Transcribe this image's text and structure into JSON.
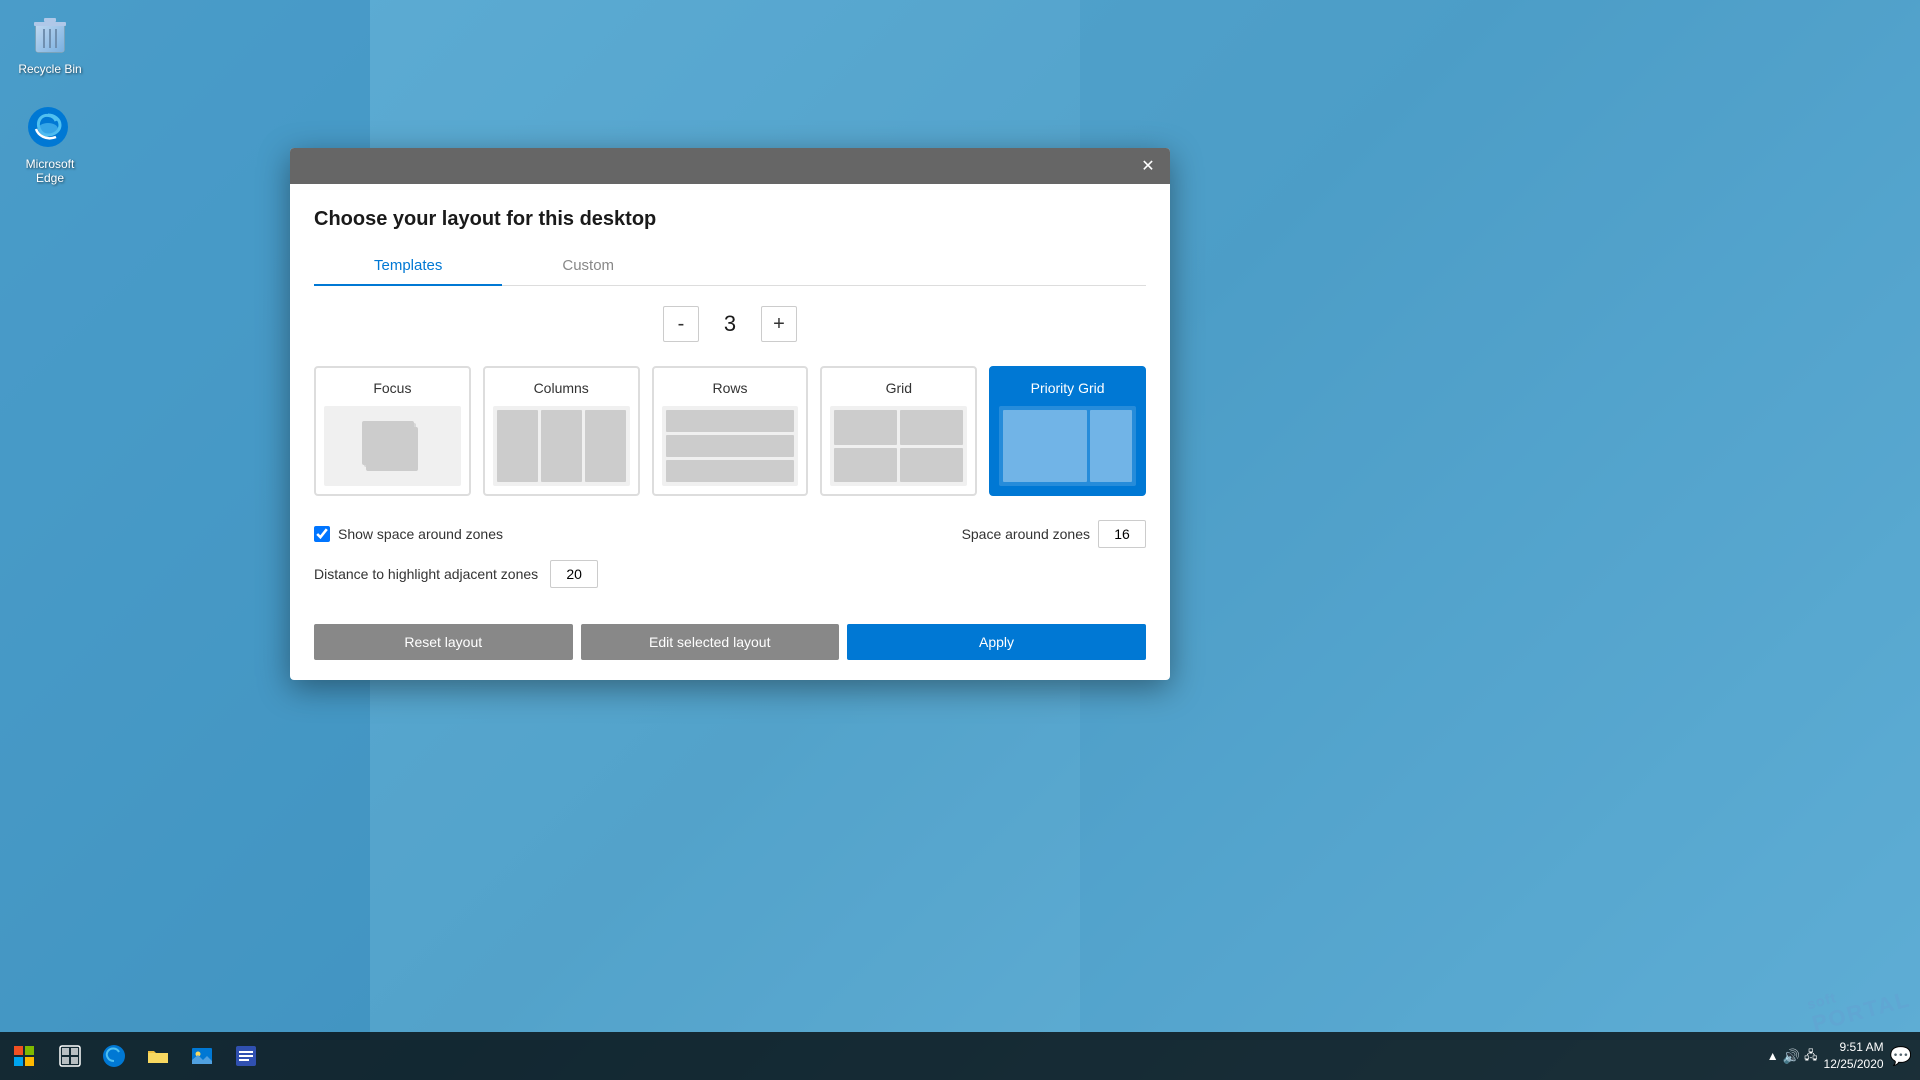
{
  "desktop": {
    "recycle_bin_label": "Recycle Bin",
    "edge_label": "Microsoft Edge"
  },
  "dialog": {
    "title": "Choose your layout for this desktop",
    "close_label": "✕",
    "tabs": [
      {
        "id": "templates",
        "label": "Templates",
        "active": true
      },
      {
        "id": "custom",
        "label": "Custom",
        "active": false
      }
    ],
    "zone_count": {
      "minus_label": "-",
      "count": "3",
      "plus_label": "+"
    },
    "layouts": [
      {
        "id": "focus",
        "name": "Focus",
        "selected": false
      },
      {
        "id": "columns",
        "name": "Columns",
        "selected": false
      },
      {
        "id": "rows",
        "name": "Rows",
        "selected": false
      },
      {
        "id": "grid",
        "name": "Grid",
        "selected": false
      },
      {
        "id": "priority-grid",
        "name": "Priority Grid",
        "selected": true
      }
    ],
    "settings": {
      "show_space_label": "Show space around zones",
      "show_space_checked": true,
      "space_around_label": "Space around zones",
      "space_around_value": "16",
      "distance_label": "Distance to highlight adjacent zones",
      "distance_value": "20"
    },
    "buttons": {
      "reset_label": "Reset layout",
      "edit_label": "Edit selected layout",
      "apply_label": "Apply"
    }
  },
  "taskbar": {
    "start_icon": "⊞",
    "search_icon": "⊡",
    "time": "9:51 AM",
    "date": "12/25/2020",
    "notification_icon": "🗨",
    "sys_icons": [
      "🔊",
      "📶",
      "⬆"
    ]
  },
  "watermark": {
    "line1": "soft",
    "line2": "PORTAL"
  }
}
